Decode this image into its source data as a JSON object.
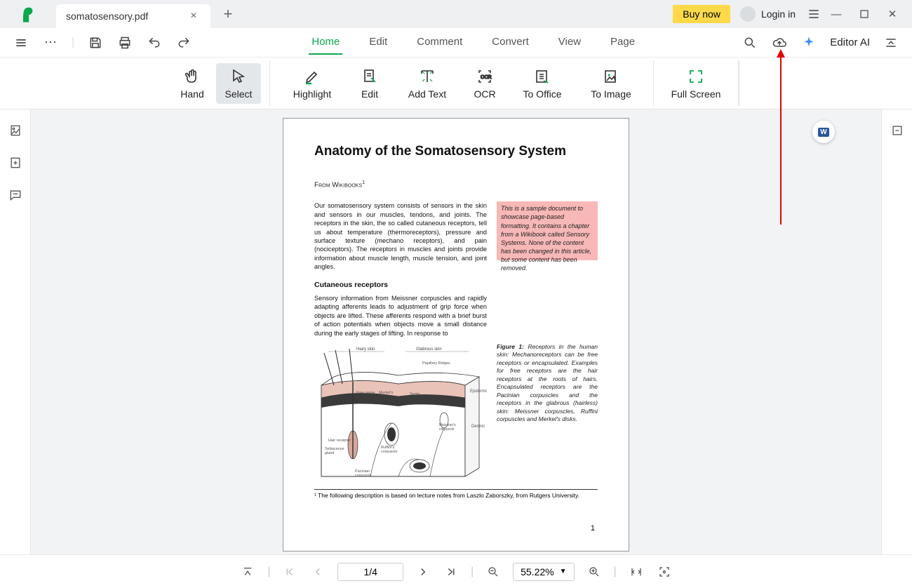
{
  "titlebar": {
    "tab_title": "somatosensory.pdf",
    "buy_label": "Buy now",
    "login_label": "Login in"
  },
  "menu": {
    "tabs": [
      "Home",
      "Edit",
      "Comment",
      "Convert",
      "View",
      "Page"
    ],
    "active": "Home",
    "editor_ai": "Editor AI"
  },
  "toolbar": {
    "hand": "Hand",
    "select": "Select",
    "highlight": "Highlight",
    "edit": "Edit",
    "add_text": "Add Text",
    "ocr": "OCR",
    "to_office": "To Office",
    "to_image": "To Image",
    "full_screen": "Full Screen"
  },
  "document": {
    "title": "Anatomy of the Somatosensory System",
    "from_line": "From Wikibooks",
    "intro_para": "Our somatosensory system consists of sensors in the skin and sensors in our muscles, tendons, and joints. The receptors in the skin, the so called cutaneous receptors, tell us about temperature (thermoreceptors), pressure and surface texture (mechano receptors), and pain (nociceptors). The receptors in muscles and joints provide information about muscle length, muscle tension, and joint angles.",
    "note_box": "This is a sample document to showcase page-based formatting. It contains a chapter from a Wikibook called Sensory Systems. None of the content has been changed in this article, but some content has been removed.",
    "section_heading": "Cutaneous receptors",
    "section_para": "Sensory information from Meissner corpuscles and rapidly adapting afferents leads to adjustment of grip force when objects are lifted. These afferents respond with a brief burst of action potentials when objects move a small distance during the early stages of lifting. In response to",
    "figure_caption_label": "Figure 1:",
    "figure_caption": "Receptors in the human skin: Mechanoreceptors can be free receptors or encapsulated. Examples for free receptors are the hair receptors at the roots of hairs. Encapsulated receptors are the Pacinian corpuscles and the receptors in the glabrous (hairless) skin: Meissner corpuscles, Ruffini corpuscles and Merkel's disks.",
    "figure_labels": {
      "hairy_skin": "Hairy skin",
      "glabrous_skin": "Glabrous skin",
      "epidermis": "Epidermis",
      "dermis": "Dermis",
      "papillary_ridges": "Papillary Ridges",
      "merkels": "Merkel's",
      "free_nerve": "Free nerve ending",
      "meissners": "Meissner's corpuscle",
      "hair_receptor": "Hair receptor",
      "ruffinis": "Ruffini's corpuscle",
      "septa": "Septa",
      "pacinian": "Pacinian corpuscle"
    },
    "footnote": "¹ The following description is based on lecture notes from Laszlo Zaborszky, from Rutgers University.",
    "page_number": "1"
  },
  "statusbar": {
    "page_indicator": "1/4",
    "zoom_value": "55.22%"
  },
  "icons": {
    "hamburger": "menu-icon",
    "more": "more-icon",
    "save": "save-icon",
    "print": "print-icon",
    "undo": "undo-icon",
    "redo": "redo-icon",
    "search": "search-icon",
    "cloud": "cloud-upload-icon",
    "sparkle": "sparkle-icon",
    "collapse": "collapse-icon"
  }
}
